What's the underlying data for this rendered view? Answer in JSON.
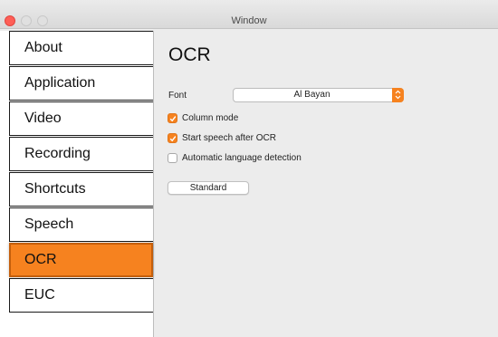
{
  "window": {
    "title": "Window"
  },
  "sidebar": {
    "items": [
      {
        "label": "About",
        "active": false
      },
      {
        "label": "Application",
        "active": false
      },
      {
        "label": "Video",
        "active": false
      },
      {
        "label": "Recording",
        "active": false
      },
      {
        "label": "Shortcuts",
        "active": false
      },
      {
        "label": "Speech",
        "active": false
      },
      {
        "label": "OCR",
        "active": true
      },
      {
        "label": "EUC",
        "active": false
      }
    ]
  },
  "main": {
    "title": "OCR",
    "font": {
      "label": "Font",
      "value": "Al Bayan"
    },
    "options": [
      {
        "label": "Column mode",
        "checked": true
      },
      {
        "label": "Start speech after OCR",
        "checked": true
      },
      {
        "label": "Automatic language detection",
        "checked": false
      }
    ],
    "standard_button": "Standard"
  },
  "colors": {
    "accent": "#f6821f",
    "close": "#fe5f57"
  }
}
